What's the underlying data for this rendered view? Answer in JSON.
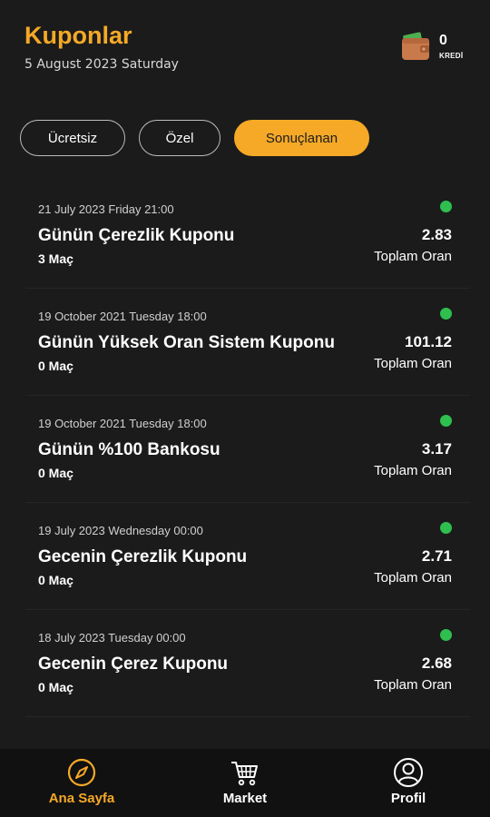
{
  "header": {
    "title": "Kuponlar",
    "date": "5 August 2023 Saturday",
    "credits": {
      "count": "0",
      "label": "KREDİ"
    }
  },
  "tabs": [
    {
      "label": "Ücretsiz",
      "active": false
    },
    {
      "label": "Özel",
      "active": false
    },
    {
      "label": "Sonuçlanan",
      "active": true
    }
  ],
  "coupons": [
    {
      "date": "21 July 2023 Friday  21:00",
      "name": "Günün Çerezlik Kuponu",
      "matches": "3 Maç",
      "odds": "2.83",
      "odds_label": "Toplam Oran",
      "status_color": "#2ebf4f"
    },
    {
      "date": "19 October 2021 Tuesday  18:00",
      "name": "Günün Yüksek Oran Sistem Kuponu",
      "matches": "0 Maç",
      "odds": "101.12",
      "odds_label": "Toplam Oran",
      "status_color": "#2ebf4f"
    },
    {
      "date": "19 October 2021 Tuesday  18:00",
      "name": "Günün %100 Bankosu",
      "matches": "0 Maç",
      "odds": "3.17",
      "odds_label": "Toplam Oran",
      "status_color": "#2ebf4f"
    },
    {
      "date": "19 July 2023 Wednesday  00:00",
      "name": "Gecenin Çerezlik Kuponu",
      "matches": "0 Maç",
      "odds": "2.71",
      "odds_label": "Toplam Oran",
      "status_color": "#2ebf4f"
    },
    {
      "date": "18 July 2023 Tuesday  00:00",
      "name": "Gecenin Çerez Kuponu",
      "matches": "0 Maç",
      "odds": "2.68",
      "odds_label": "Toplam Oran",
      "status_color": "#2ebf4f"
    }
  ],
  "navbar": [
    {
      "label": "Ana Sayfa",
      "icon": "compass-icon",
      "active": true
    },
    {
      "label": "Market",
      "icon": "cart-icon",
      "active": false
    },
    {
      "label": "Profil",
      "icon": "user-icon",
      "active": false
    }
  ],
  "colors": {
    "accent": "#f5a927",
    "background": "#1b1b1b",
    "status_green": "#2ebf4f"
  }
}
